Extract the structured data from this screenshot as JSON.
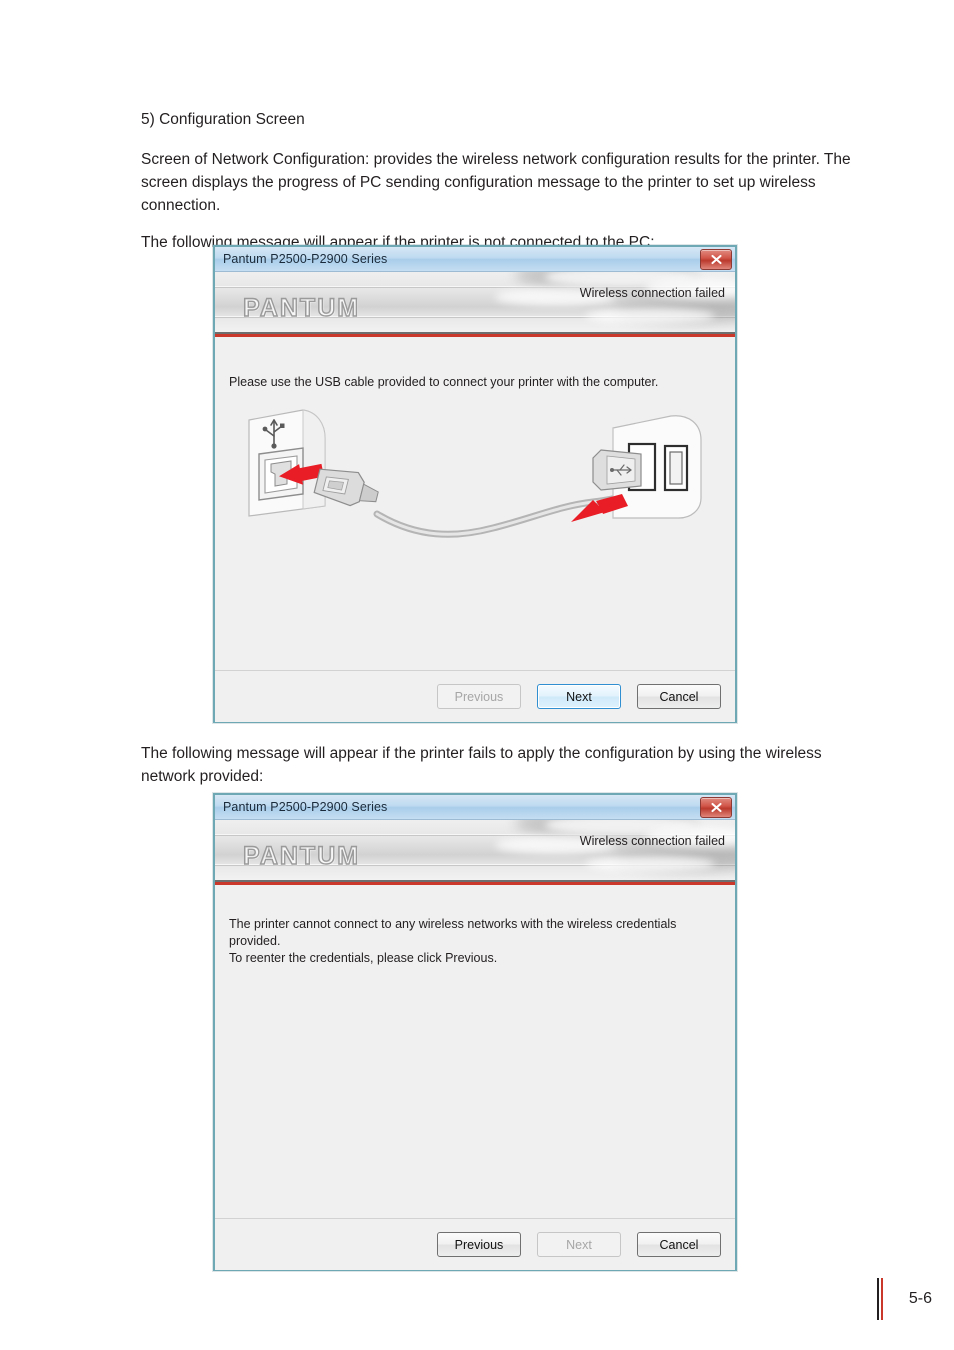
{
  "document": {
    "paragraphs": [
      "5) Configuration Screen",
      "Screen of Network Configuration: provides the wireless network configuration results for the printer. The screen displays the progress of PC sending configuration message to the printer to set up wireless connection.",
      "The following message will appear if the printer is not connected to the PC:",
      "The following message will appear if the printer fails to apply the configuration by using the wireless network provided:"
    ],
    "page_number": "5-6"
  },
  "dialog_one": {
    "title": "Pantum P2500-P2900 Series",
    "close_label": "x",
    "logo": "PANTUM",
    "status": "Wireless connection failed",
    "message": "Please use the USB cable provided to connect your printer with the computer.",
    "illustration": "usb-cable-connection-diagram",
    "buttons": [
      {
        "label": "Previous",
        "state": "disabled"
      },
      {
        "label": "Next",
        "state": "default"
      },
      {
        "label": "Cancel",
        "state": "normal"
      }
    ]
  },
  "dialog_two": {
    "title": "Pantum P2500-P2900 Series",
    "close_label": "x",
    "logo": "PANTUM",
    "status": "Wireless connection failed",
    "message": "The printer cannot connect to any wireless networks with the wireless credentials\nprovided.\nTo reenter the credentials, please click Previous.",
    "buttons": [
      {
        "label": "Previous",
        "state": "normal"
      },
      {
        "label": "Next",
        "state": "disabled"
      },
      {
        "label": "Cancel",
        "state": "normal"
      }
    ]
  },
  "colors": {
    "accent_red": "#c9382a",
    "titlebar_blue": "#a9cdea",
    "dialog_border": "#6fa8b5",
    "close_red": "#bb3a2d"
  }
}
